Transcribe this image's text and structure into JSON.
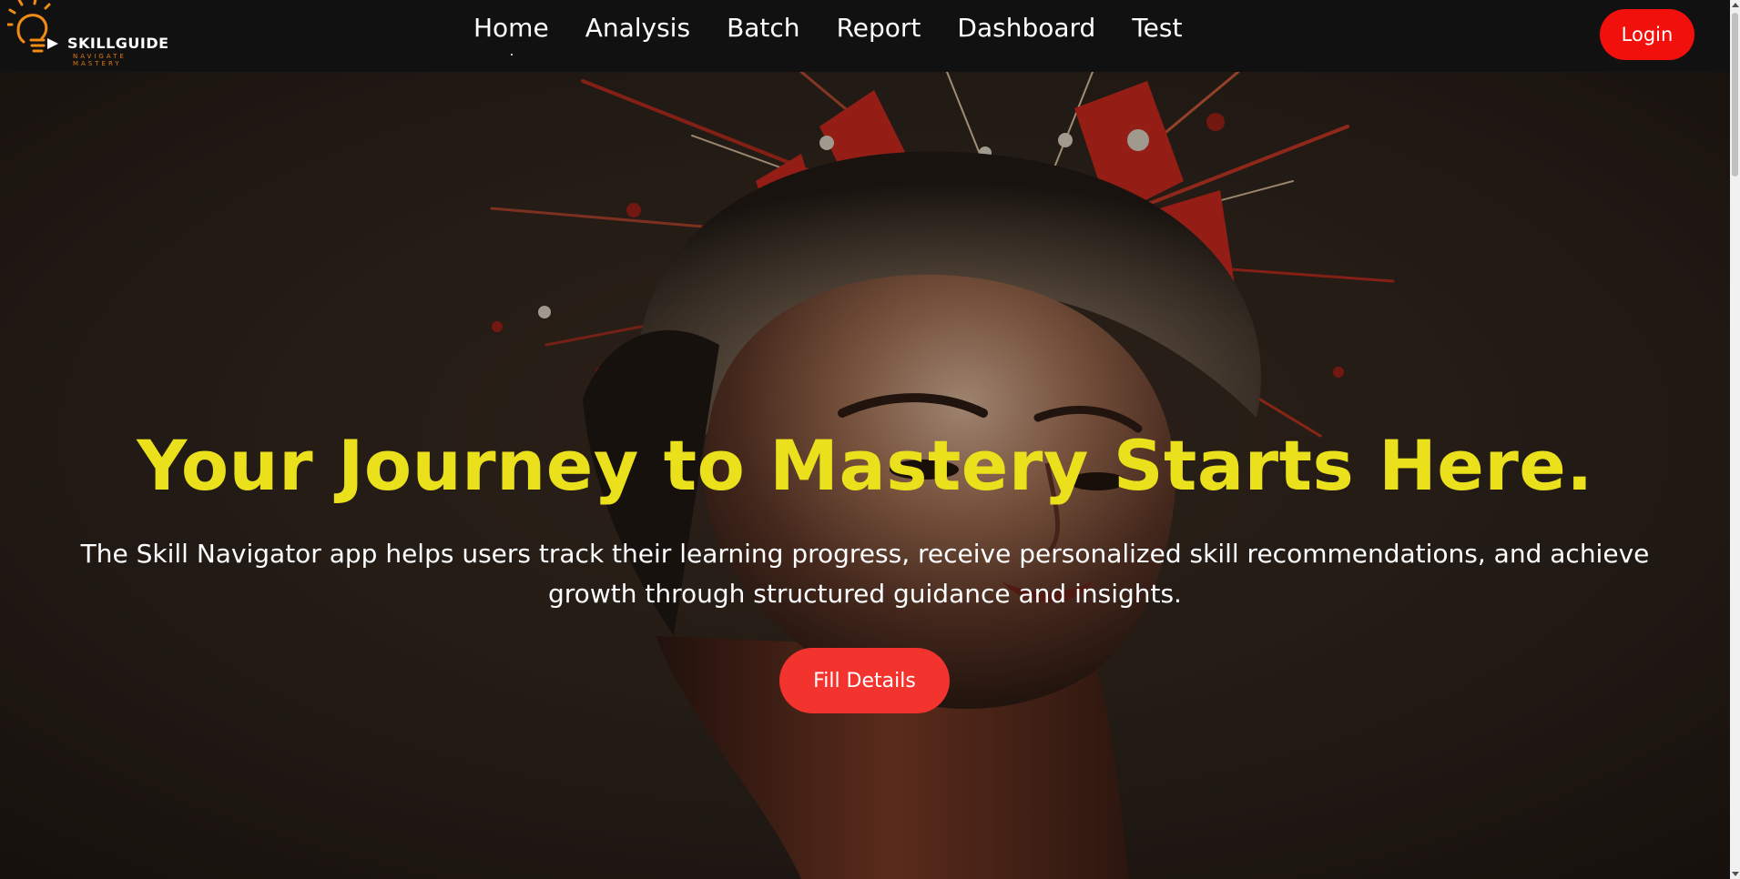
{
  "brand": {
    "name": "SKILLGUIDE",
    "tagline": "NAVIGATE MASTERY",
    "icon": "lightbulb-icon"
  },
  "nav": {
    "items": [
      {
        "label": "Home",
        "active": true
      },
      {
        "label": "Analysis",
        "active": false
      },
      {
        "label": "Batch",
        "active": false
      },
      {
        "label": "Report",
        "active": false
      },
      {
        "label": "Dashboard",
        "active": false
      },
      {
        "label": "Test",
        "active": false
      }
    ],
    "login_label": "Login"
  },
  "hero": {
    "title": "Your Journey to Mastery Starts Here.",
    "description": "The Skill Navigator app helps users track their learning progress, receive personalized skill recommendations, and achieve growth through structured guidance and insights.",
    "cta_label": "Fill Details",
    "image": "portrait-with-red-paint-splash"
  },
  "colors": {
    "navbar_bg": "#111111",
    "accent_red": "#f2100d",
    "cta_red": "#f2332e",
    "title_yellow": "#ebe01c",
    "brand_orange": "#e07a12"
  }
}
